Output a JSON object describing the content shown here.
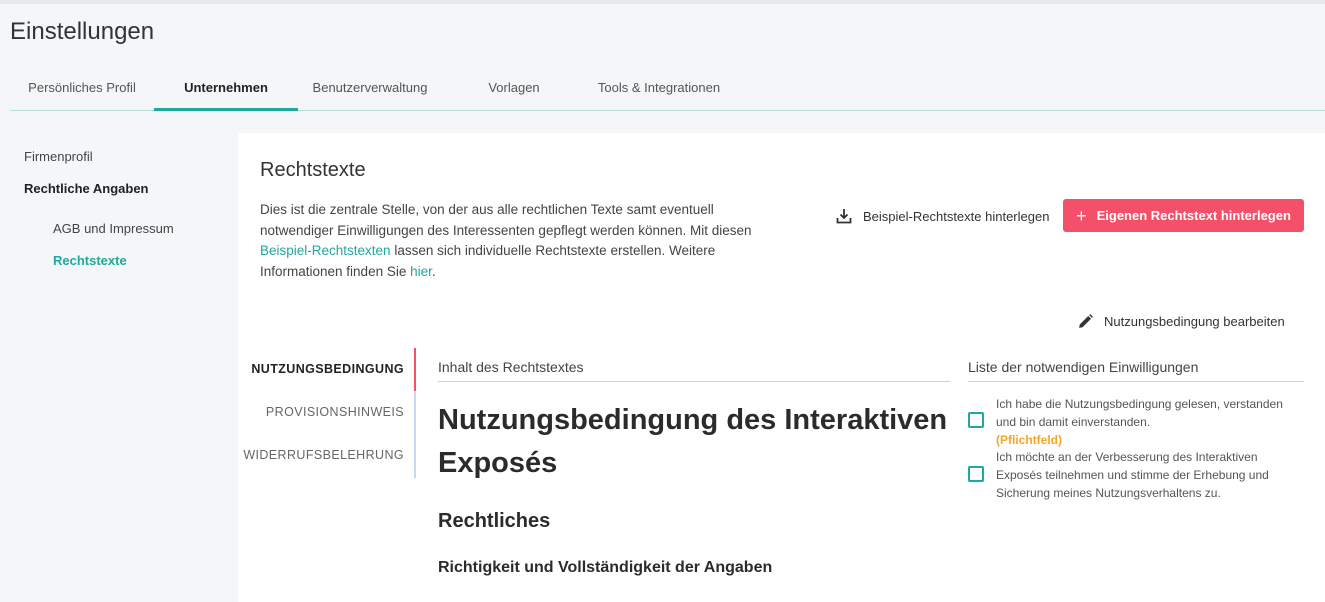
{
  "page": {
    "title": "Einstellungen"
  },
  "tabs": [
    {
      "label": "Persönliches Profil"
    },
    {
      "label": "Unternehmen"
    },
    {
      "label": "Benutzerverwaltung"
    },
    {
      "label": "Vorlagen"
    },
    {
      "label": "Tools & Integrationen"
    }
  ],
  "sidebar": {
    "firmenprofil": "Firmenprofil",
    "rechtliche_angaben": "Rechtliche Angaben",
    "agb": "AGB und Impressum",
    "rechtstexte": "Rechtstexte"
  },
  "section": {
    "title": "Rechtstexte",
    "desc_part1": "Dies ist die zentrale Stelle, von der aus alle rechtlichen Texte samt eventuell notwendiger Einwilligungen des Interessenten gepflegt werden können. Mit diesen ",
    "desc_link1": "Beispiel-Rechtstexten",
    "desc_part2": " lassen sich individuelle Rechtstexte erstellen. Weitere Informationen finden Sie ",
    "desc_link2": "hier",
    "desc_part3": "."
  },
  "buttons": {
    "sample": "Beispiel-Rechtstexte hinterlegen",
    "own": "Eigenen Rechtstext hinterlegen",
    "edit": "Nutzungsbedingung bearbeiten"
  },
  "doc_tabs": [
    {
      "label": "NUTZUNGSBEDINGUNG"
    },
    {
      "label": "PROVISIONSHINWEIS"
    },
    {
      "label": "WIDERRUFSBELEHRUNG"
    }
  ],
  "content": {
    "header": "Inhalt des Rechtstextes",
    "h1": "Nutzungsbedingung des Interaktiven Exposés",
    "h2": "Rechtliches",
    "h3": "Richtigkeit und Vollständigkeit der Angaben"
  },
  "consents": {
    "header": "Liste der notwendigen Einwilligungen",
    "items": [
      {
        "text": "Ich habe die Nutzungsbedingung gelesen, verstanden und bin damit einverstanden.",
        "required": "(Pflichtfeld)"
      },
      {
        "text": "Ich möchte an der Verbesserung des Interaktiven Exposés teilnehmen und stimme der Erhebung und Sicherung meines Nutzungsverhaltens zu."
      }
    ]
  },
  "icons": {
    "download": "download-icon",
    "plus": "plus-icon",
    "pencil": "pencil-icon"
  },
  "colors": {
    "accent": "#1fa99c",
    "primary_button": "#f4506a",
    "required": "#f5a623"
  }
}
